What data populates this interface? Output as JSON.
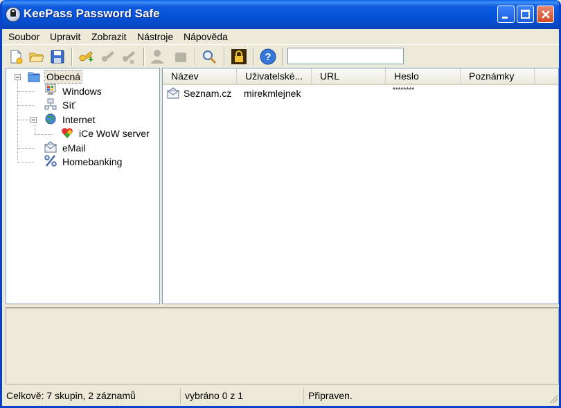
{
  "window": {
    "title": "KeePass Password Safe"
  },
  "menu": [
    "Soubor",
    "Upravit",
    "Zobrazit",
    "Nástroje",
    "Nápověda"
  ],
  "search": {
    "value": ""
  },
  "tree": {
    "items": [
      {
        "label": "Obecná",
        "icon": "folder-icon",
        "selected": true
      },
      {
        "label": "Windows",
        "icon": "windows-icon"
      },
      {
        "label": "Síť",
        "icon": "network-icon"
      },
      {
        "label": "Internet",
        "icon": "globe-icon"
      },
      {
        "label": "iCe WoW server",
        "icon": "heart-icon"
      },
      {
        "label": "eMail",
        "icon": "envelope-icon"
      },
      {
        "label": "Homebanking",
        "icon": "percent-icon"
      }
    ]
  },
  "list": {
    "columns": [
      "Název",
      "Uživatelské...",
      "URL",
      "Heslo",
      "Poznámky"
    ],
    "rows": [
      {
        "title": "Seznam.cz",
        "user": "mirekmlejnek",
        "url": "",
        "password": "********",
        "notes": ""
      }
    ]
  },
  "status": {
    "totals": "Celkově: 7 skupin, 2 záznamů",
    "selection": "vybráno 0 z 1",
    "state": "Připraven."
  },
  "colors": {
    "title_bar": "#0552d8",
    "window_bg": "#ece9d8",
    "close_button": "#d24a24"
  }
}
